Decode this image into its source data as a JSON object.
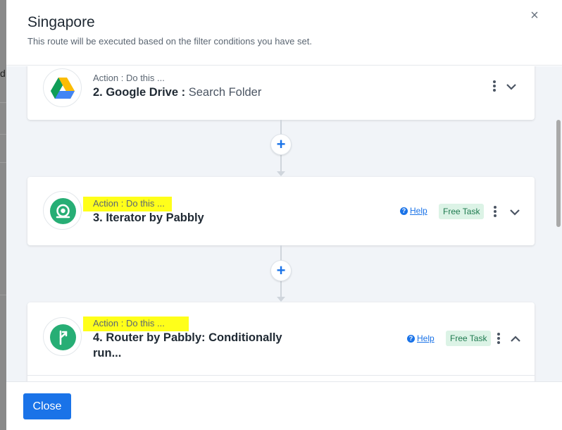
{
  "background": {
    "fragment_letter": "d"
  },
  "modal": {
    "title": "Singapore",
    "subtitle": "This route will be executed based on the filter conditions you have set.",
    "close_icon": "×"
  },
  "steps": [
    {
      "action_label": "Action : Do this ...",
      "title": "2. Google Drive :",
      "subtitle": "Search Folder",
      "icon": "google-drive-icon",
      "expanded": false
    },
    {
      "action_label": "Action : Do this ...",
      "title": "3. Iterator by Pabbly",
      "icon": "iterator-icon",
      "help": "Help",
      "badge": "Free Task",
      "expanded": false
    },
    {
      "action_label": "Action : Do this ...",
      "title": "4. Router by Pabbly: Conditionally run...",
      "icon": "router-icon",
      "help": "Help",
      "badge": "Free Task",
      "expanded": true
    }
  ],
  "footer": {
    "close_label": "Close"
  },
  "colors": {
    "accent": "#1a73e8",
    "badge_bg": "#dcf3e6",
    "badge_text": "#1e7a4f",
    "app_icon_green": "#27ae75",
    "highlight": "#ffff1a"
  }
}
